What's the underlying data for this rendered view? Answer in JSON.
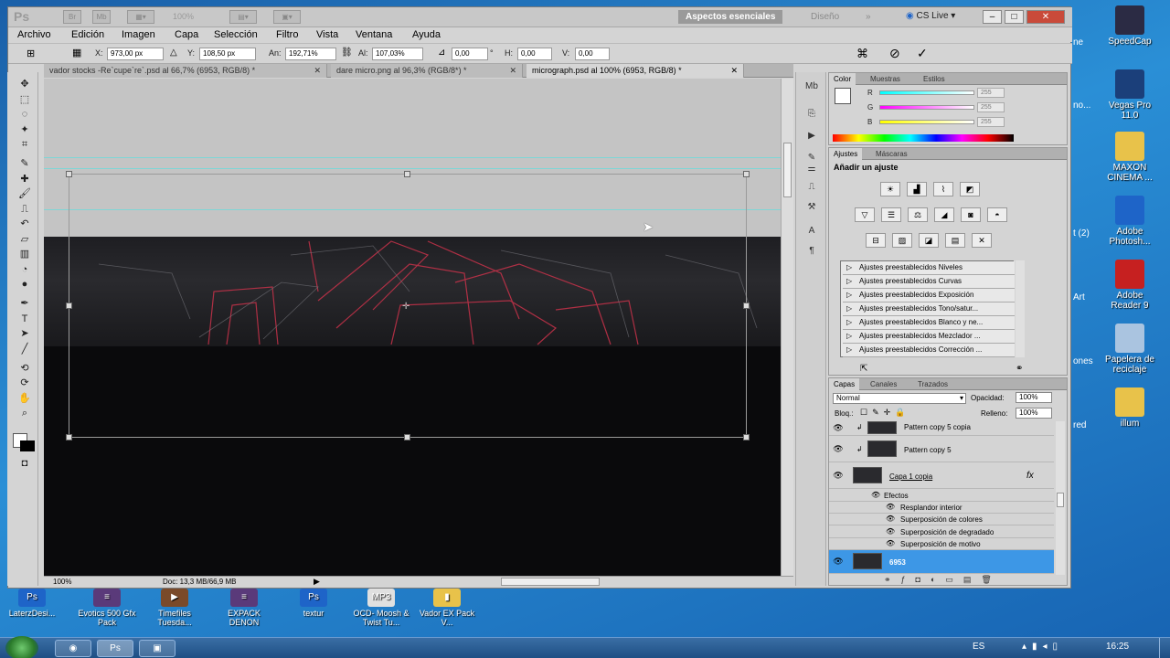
{
  "app": {
    "logo": "Ps",
    "zoom_select": "100%",
    "workspace_active": "Aspectos esenciales",
    "workspace_other": "Diseño",
    "more": "»",
    "cs_live": "CS Live",
    "win_min": "–",
    "win_max": "□",
    "win_close": "✕"
  },
  "menu": [
    "Archivo",
    "Edición",
    "Imagen",
    "Capa",
    "Selección",
    "Filtro",
    "Vista",
    "Ventana",
    "Ayuda"
  ],
  "options": {
    "x_label": "X:",
    "x_value": "973,00 px",
    "y_label": "Y:",
    "y_value": "108,50 px",
    "w_label": "An:",
    "w_value": "192,71%",
    "h_label": "Al:",
    "h_value": "107,03%",
    "angle_value": "0,00",
    "angle_unit": "°",
    "hskew_label": "H:",
    "hskew_value": "0,00",
    "vskew_label": "V:",
    "vskew_value": "0,00"
  },
  "tabs": [
    {
      "label": "vador stocks -Re`cupe`re`.psd al 66,7% (6953, RGB/8) *",
      "active": false
    },
    {
      "label": "dare micro.png al 96,3% (RGB/8*) *",
      "active": false
    },
    {
      "label": "micrograph.psd al 100% (6953, RGB/8) *",
      "active": true
    }
  ],
  "status": {
    "zoom": "100%",
    "doc": "Doc: 13,3 MB/66,9 MB"
  },
  "color_panel": {
    "tabs": [
      "Color",
      "Muestras",
      "Estilos"
    ],
    "r_label": "R",
    "r_value": "255",
    "g_label": "G",
    "g_value": "255",
    "b_label": "B",
    "b_value": "255"
  },
  "adjust_panel": {
    "tabs": [
      "Ajustes",
      "Máscaras"
    ],
    "title": "Añadir un ajuste",
    "presets": [
      "Ajustes preestablecidos Niveles",
      "Ajustes preestablecidos Curvas",
      "Ajustes preestablecidos Exposición",
      "Ajustes preestablecidos Tono/satur...",
      "Ajustes preestablecidos Blanco y ne...",
      "Ajustes preestablecidos Mezclador ...",
      "Ajustes preestablecidos Corrección ..."
    ]
  },
  "layers_panel": {
    "tabs": [
      "Capas",
      "Canales",
      "Trazados"
    ],
    "blend_mode": "Normal",
    "opacity_label": "Opacidad:",
    "opacity_value": "100%",
    "lock_label": "Bloq.:",
    "fill_label": "Relleno:",
    "fill_value": "100%",
    "layers": [
      {
        "name": "Pattern copy 5 copia"
      },
      {
        "name": "Pattern copy 5"
      },
      {
        "name": "Capa 1 copia",
        "fx": "fx"
      }
    ],
    "effects_label": "Efectos",
    "effects": [
      "Resplandor interior",
      "Superposición de colores",
      "Superposición de degradado",
      "Superposición de motivo"
    ],
    "selected_layer": "6953"
  },
  "desktop_right": [
    {
      "label": "SpeedCap",
      "color": "#2b2b44"
    },
    {
      "label": "Vegas Pro 11.0",
      "color": "#1b3f7a"
    },
    {
      "label": "MAXON CINEMA ...",
      "color": "#e8c24a"
    },
    {
      "label": "Adobe Photosh...",
      "color": "#1e64c8"
    },
    {
      "label": "Adobe Reader 9",
      "color": "#c62020"
    },
    {
      "label": "Papelera de reciclaje",
      "color": "#aac4e0"
    },
    {
      "label": "illum",
      "color": "#e8c24a"
    }
  ],
  "desktop_bottom": [
    {
      "label": "LaterzDesi...",
      "color": "#1e64c8",
      "glyph": "Ps"
    },
    {
      "label": "Evotics 500 Gfx Pack",
      "color": "#5a3a7a",
      "glyph": "≡"
    },
    {
      "label": "Timefiles Tuesda...",
      "color": "#7a4a2a",
      "glyph": "▶"
    },
    {
      "label": "EXPACK DENON",
      "color": "#5a3a7a",
      "glyph": "≡"
    },
    {
      "label": "textur",
      "color": "#1e64c8",
      "glyph": "Ps"
    },
    {
      "label": "OCD- Moosh & Twist Tu...",
      "color": "#e0e0e0",
      "glyph": "MP3"
    },
    {
      "label": "Vador EX Pack V...",
      "color": "#e8c24a",
      "glyph": "▮"
    }
  ],
  "desktop_partial": [
    "ne",
    "no...",
    "t (2)",
    "Art",
    "ones",
    "red"
  ],
  "taskbar": {
    "lang": "ES",
    "time": "16:25"
  }
}
